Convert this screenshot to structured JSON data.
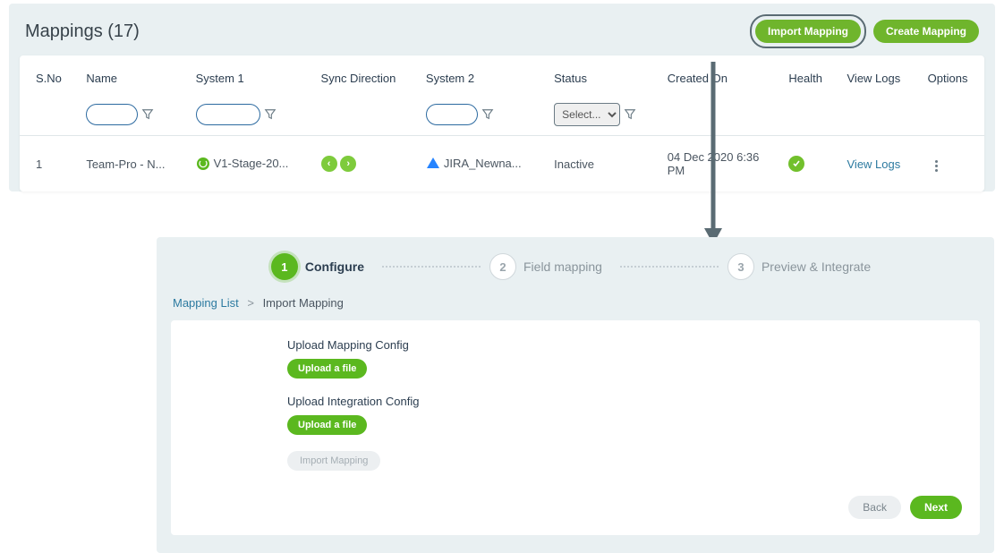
{
  "header": {
    "title": "Mappings (17)",
    "import_btn": "Import Mapping",
    "create_btn": "Create Mapping"
  },
  "table": {
    "cols": {
      "sno": "S.No",
      "name": "Name",
      "sys1": "System 1",
      "sync": "Sync Direction",
      "sys2": "System 2",
      "status": "Status",
      "created": "Created On",
      "health": "Health",
      "logs": "View Logs",
      "options": "Options"
    },
    "filter_select_placeholder": "Select...",
    "row": {
      "sno": "1",
      "name": "Team-Pro - N...",
      "sys1": "V1-Stage-20...",
      "sys2": "JIRA_Newna...",
      "status": "Inactive",
      "created": "04 Dec 2020 6:36 PM",
      "logs": "View Logs"
    }
  },
  "stepper": {
    "s1_num": "1",
    "s1_label": "Configure",
    "s2_num": "2",
    "s2_label": "Field mapping",
    "s3_num": "3",
    "s3_label": "Preview & Integrate"
  },
  "breadcrumb": {
    "root": "Mapping List",
    "sep": ">",
    "current": "Import Mapping"
  },
  "form": {
    "upload_mapping_label": "Upload Mapping Config",
    "upload_mapping_btn": "Upload a file",
    "upload_integration_label": "Upload Integration Config",
    "upload_integration_btn": "Upload a file",
    "import_btn": "Import Mapping",
    "back_btn": "Back",
    "next_btn": "Next"
  }
}
